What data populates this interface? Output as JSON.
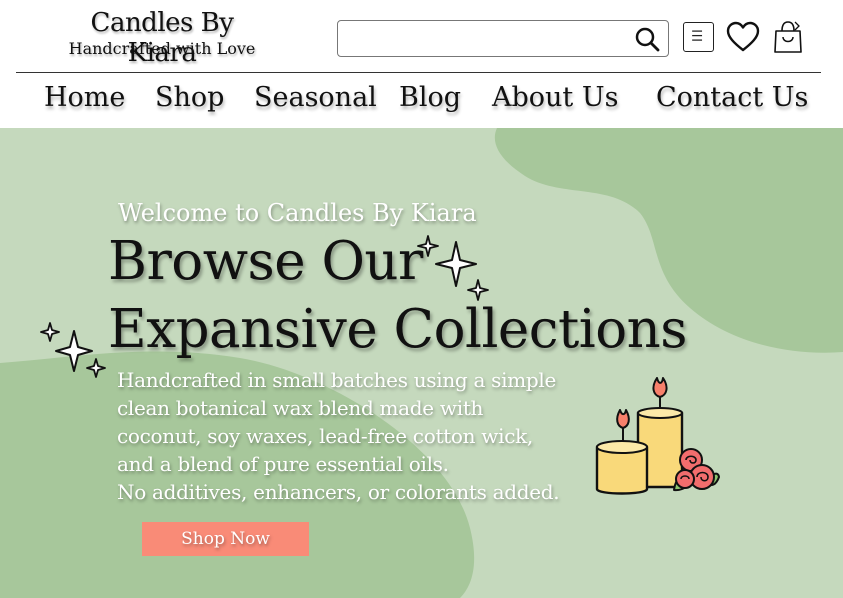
{
  "brand": {
    "title": "Candles By Kiara",
    "tagline": "Handcrafted with Love"
  },
  "search": {
    "value": "",
    "placeholder": ""
  },
  "header_icons": [
    "search-icon",
    "menu-icon",
    "heart-icon",
    "shopping-bag-icon"
  ],
  "nav": {
    "items": [
      "Home",
      "Shop",
      "Seasonal",
      "Blog",
      "About Us",
      "Contact Us"
    ]
  },
  "hero": {
    "welcome": "Welcome to Candles By Kiara",
    "heading_line1": "Browse Our",
    "heading_line2": "Expansive Collections",
    "body_lines": [
      "Handcrafted in small batches using a simple",
      "clean botanical wax blend made with",
      "coconut, soy waxes, lead-free cotton wick,",
      "and a blend of pure essential oils.",
      "No additives, enhancers, or colorants  added."
    ],
    "cta_label": "Shop Now"
  },
  "colors": {
    "hero_bg": "#c5d9bd",
    "hero_blob": "#a7c79b",
    "cta": "#f98b77",
    "candle_wax": "#f9d97a",
    "flame": "#f7806b",
    "rose": "#f26d6d",
    "leaf": "#8cc56f"
  }
}
